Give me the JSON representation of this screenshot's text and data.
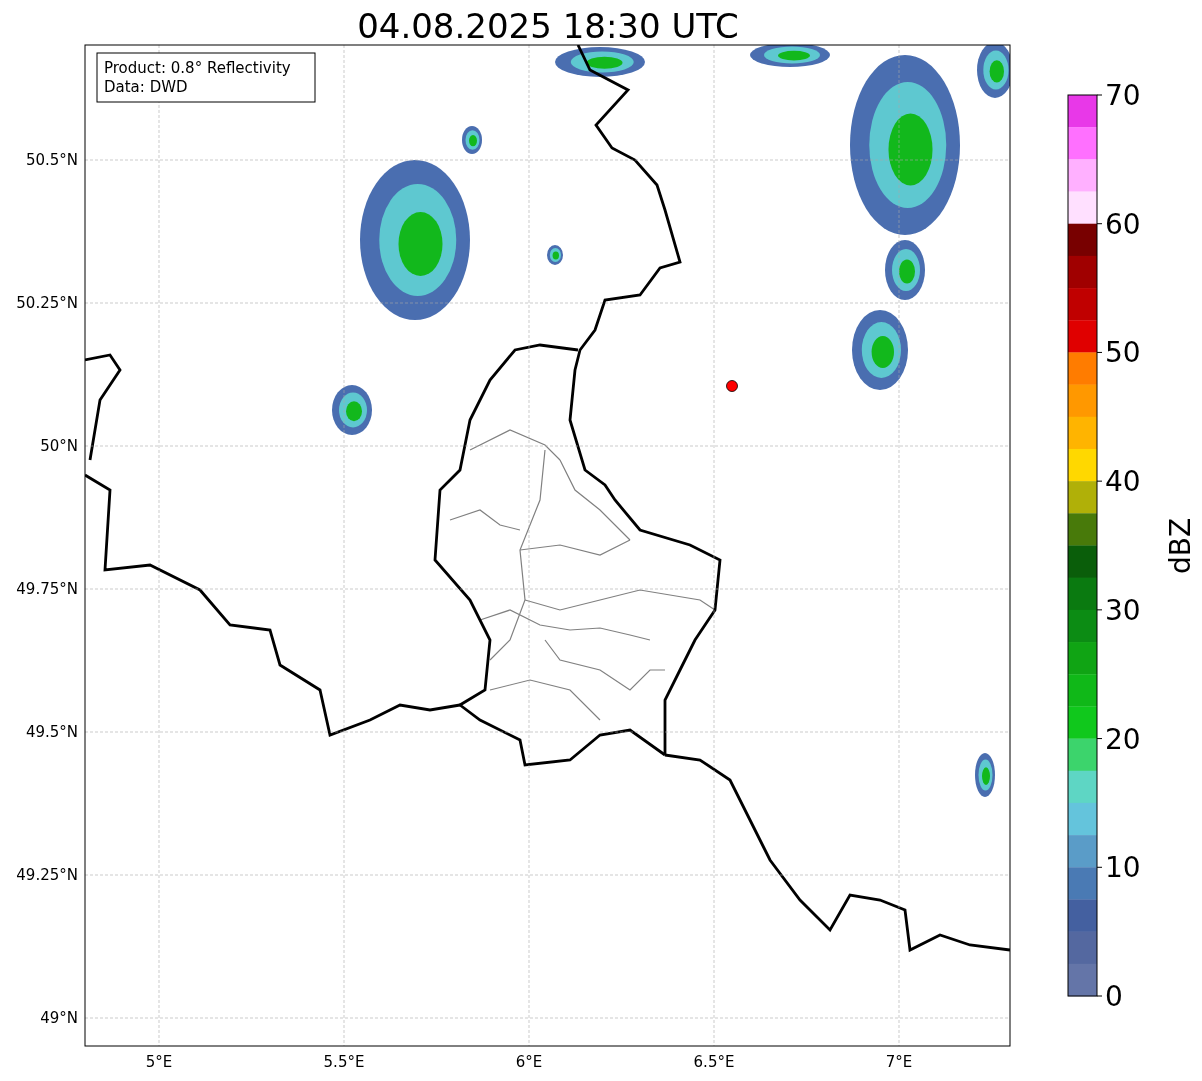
{
  "title": "04.08.2025 18:30 UTC",
  "info_box": [
    "Product: 0.8° Reflectivity",
    "Data: DWD"
  ],
  "map": {
    "lat_ticks": [
      "50.5°N",
      "50.25°N",
      "50°N",
      "49.75°N",
      "49.5°N",
      "49.25°N",
      "49°N"
    ],
    "lon_ticks": [
      "5°E",
      "5.5°E",
      "6°E",
      "6.5°E",
      "7°E"
    ]
  },
  "colorbar": {
    "label": "dBZ",
    "ticks": [
      "70",
      "60",
      "50",
      "40",
      "30",
      "20",
      "10",
      "0"
    ],
    "bins": [
      {
        "color": "#e838e8"
      },
      {
        "color": "#ff70ff"
      },
      {
        "color": "#ffb0ff"
      },
      {
        "color": "#ffe0ff"
      },
      {
        "color": "#780000"
      },
      {
        "color": "#a00000"
      },
      {
        "color": "#c00000"
      },
      {
        "color": "#e00000"
      },
      {
        "color": "#ff7c00"
      },
      {
        "color": "#ff9800"
      },
      {
        "color": "#ffb400"
      },
      {
        "color": "#ffd800"
      },
      {
        "color": "#b0b008"
      },
      {
        "color": "#487a0a"
      },
      {
        "color": "#0a5e0a"
      },
      {
        "color": "#0a7a10"
      },
      {
        "color": "#0c8c14"
      },
      {
        "color": "#10a414"
      },
      {
        "color": "#10b818"
      },
      {
        "color": "#10c81c"
      },
      {
        "color": "#3cd46c"
      },
      {
        "color": "#5ed6c4"
      },
      {
        "color": "#64c4dc"
      },
      {
        "color": "#5a9cc8"
      },
      {
        "color": "#4a7ab4"
      },
      {
        "color": "#4460a0"
      },
      {
        "color": "#5468a0"
      },
      {
        "color": "#6475a8"
      }
    ]
  }
}
